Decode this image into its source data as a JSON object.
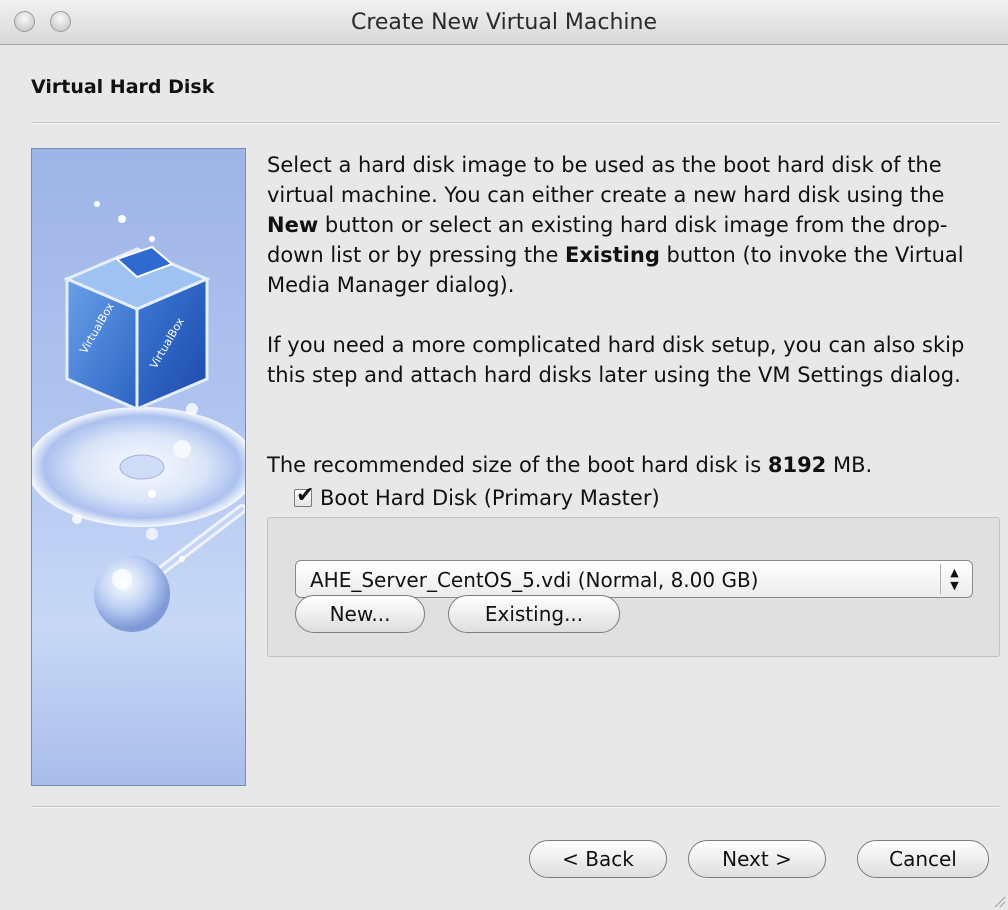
{
  "window": {
    "title": "Create New Virtual Machine"
  },
  "page": {
    "title": "Virtual Hard Disk"
  },
  "description": {
    "p1_a": "Select a hard disk image to be used as the boot hard disk of the virtual machine. You can either create a new hard disk using the ",
    "p1_new": "New",
    "p1_b": " button or select an existing hard disk image from the drop-down list or by pressing the ",
    "p1_existing": "Existing",
    "p1_c": " button (to invoke the Virtual Media Manager dialog).",
    "p2": "If you need a more complicated hard disk setup, you can also skip this step and attach hard disks later using the VM Settings dialog.",
    "p3_a": "The recommended size of the boot hard disk is ",
    "p3_size": "8192",
    "p3_unit": " MB."
  },
  "boot_disk": {
    "checkbox_label": "Boot Hard Disk (Primary Master)",
    "checked": true,
    "selected": "AHE_Server_CentOS_5.vdi (Normal, 8.00 GB)",
    "new_label": "New...",
    "existing_label": "Existing..."
  },
  "footer": {
    "back_label": "< Back",
    "next_label": "Next >",
    "cancel_label": "Cancel"
  },
  "icons": {
    "checkmark": "✔",
    "select_arrows": "▲▼"
  },
  "colors": {
    "side_panel": "#a9bdea",
    "background": "#e8e8e8"
  }
}
